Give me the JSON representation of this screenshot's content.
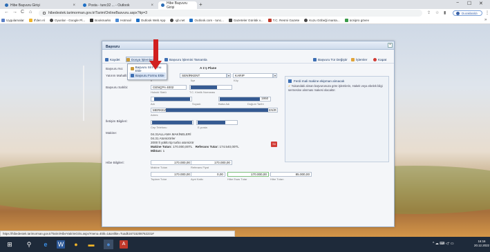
{
  "browser": {
    "tabs": [
      {
        "label": "Hibe Başvuru Girişi",
        "active": false
      },
      {
        "label": "Posta - tunc32 ... - Outlook",
        "active": false
      },
      {
        "label": "Hibe Başvuru Girişi",
        "active": true
      }
    ],
    "new_tab": "+",
    "window_controls": {
      "minimize": "−",
      "maximize": "☐",
      "close": "✕"
    },
    "nav": {
      "back": "←",
      "forward": "→",
      "reload": "C",
      "home": "⌂"
    },
    "url": "hibedestek.tarimorman.gov.tr/Tarim/OnlineBasvuru.aspx?tip=3",
    "profile_label": "Duraklatıldı",
    "right_icons": [
      "share-icon",
      "star-icon",
      "sidepanel-icon"
    ],
    "menu": "⋮",
    "bookmarks": [
      {
        "label": "Uygulamalar",
        "color": "#5a7fc6"
      },
      {
        "label": "If'den Al",
        "color": "#f0b429"
      },
      {
        "label": "Oyunlar - Google Pl...",
        "color": "#444444"
      },
      {
        "label": "Bookmarks",
        "color": "#333333"
      },
      {
        "label": "Hotmail",
        "color": "#4a8ad4"
      },
      {
        "label": "Outlook Web App",
        "color": "#1e6fc5"
      },
      {
        "label": "ıgb.net",
        "color": "#444444"
      },
      {
        "label": "Outlook.com - tunc...",
        "color": "#1e6fc5"
      },
      {
        "label": "Gazeteler Günlük v...",
        "color": "#444444"
      },
      {
        "label": "T.C. Resmi Gazete",
        "color": "#c0392b"
      },
      {
        "label": "Kuzu Göbeği manta...",
        "color": "#444444"
      },
      {
        "label": "ücsipro gövev",
        "color": "#3a9b4a"
      }
    ],
    "menu_more": "»",
    "status_url": "https://hibedestek.tarimorman.gov.tr/Tarim/HibeYatirimGiris.aspx?menu=Etik=1&onlike=Tuadk16715208762231#"
  },
  "dialog": {
    "title": "Başvuru",
    "close": "×",
    "toolbar": {
      "kaydet": "Kaydet",
      "dosya_islemleri": "Dosya İşlemleri",
      "basvuru_tamamla": "Başvuru İşlemini Tamamla",
      "tur_degistir": "Başvuru Tür Değiştir",
      "islemler": "İşlemler",
      "kapat": "Kapat"
    },
    "dropdown_items": [
      "Başvuru Sil Formu Ekle",
      "Başvuru Formu Ekle"
    ],
    "labels": {
      "basvuru_no": "Başvuru No:",
      "yatirim_mahal": "Yatırım Mahalli:",
      "basvuru_sahibi": "Başvuru Sahibi:",
      "iletisim": "İletişim Bilgileri:",
      "makine": "Makine:",
      "hibe": "Hibe Bilgileri:"
    },
    "plan_label": "A 1'ş Plane",
    "location": {
      "il": "SENİRKENT",
      "koy": "KARIP",
      "il_cap": "İl",
      "ilce_cap": "İlçe",
      "koy_cap": "Köy"
    },
    "applicant": {
      "tax_no": "GENÇPA 4002",
      "tax_cap": "Hukuki Statü",
      "tc_cap": "T.C. Kimlik Numarası",
      "birth": "1950",
      "adi_cap": "Adı",
      "soyadi_cap": "Soyadı",
      "baba_cap": "Baba Adı",
      "dogum_cap": "Doğum Tarihi",
      "adres_prefix": "MERKEZ",
      "adres_suffix": "ENİR",
      "adres_cap": "Adres"
    },
    "contact": {
      "cep_cap": "Cep Telefonu",
      "eposta_cap": "E-posta"
    },
    "machine": {
      "line1": "04.31ALLAMA MAKİNELERİ",
      "line2": "04.31 Atomizörler",
      "line3": "2000 lt yüklü tip turbo atomizör",
      "toplam_label": "Makine Tutarı:",
      "toplam_value": "170.000,00TL",
      "referans_label": "Referans Tutar:",
      "referans_value": "174.540,00TL",
      "miktar_label": "Miktarı:",
      "miktar_value": "1",
      "delete": "Sil"
    },
    "hibe": {
      "makine_tutari": "170.000,00",
      "makine_cap": "Makine Tutarı",
      "referans_fiyat": "170.000,00",
      "referans_cap": "Referans Fiyat",
      "toplam_tutar": "170.000,00",
      "toplam_cap": "Toplam Tutar",
      "ayni_katki": "0,00",
      "ayni_cap": "Ayni Katkı",
      "hibe_oncesi": "170.000,00",
      "hibe_oncesi_cap": "Hibe Esas Tutar",
      "hibe_tutari": "85.000,00",
      "hibe_cap": "Hibe Tutarı"
    },
    "notes": {
      "note1": "Ferdi mali makine ekipman alınacak",
      "note2": "Yukarıdaki alınan başvurunuza göre işlemlerin, Hakek veya ebelek bilgi sermesine alınması makesi olacaktır."
    }
  },
  "taskbar": {
    "start": "⊞",
    "search": "⚲",
    "tray": "^ ☁ ⌨ ◁ᐩ ▭",
    "time": "16:16",
    "date": "20.12.2022"
  }
}
